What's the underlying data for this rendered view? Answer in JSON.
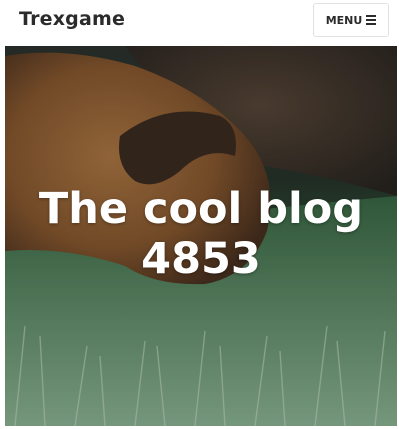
{
  "header": {
    "site_title": "Trexgame",
    "menu_label": "MENU"
  },
  "hero": {
    "title_line1": "The cool blog",
    "title_line2": "4853"
  },
  "icons": {
    "menu": "hamburger-icon"
  },
  "colors": {
    "text": "#2b2b2b",
    "hero_text": "#ffffff"
  }
}
